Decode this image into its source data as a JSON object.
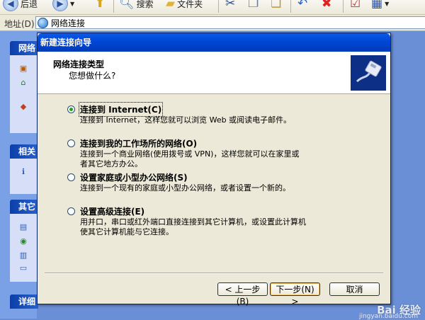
{
  "toolbar": {
    "back_label": "后退",
    "search_label": "搜索",
    "folders_label": "文件夹"
  },
  "address": {
    "label": "地址(D)",
    "value": "网络连接"
  },
  "taskpane": {
    "sections": [
      "网络",
      "相关",
      "其它",
      "详细"
    ]
  },
  "dialog": {
    "title": "新建连接向导",
    "header_title": "网络连接类型",
    "header_subtitle": "您想做什么?",
    "options": [
      {
        "label": "连接到 Internet(C)",
        "desc": "连接到 Internet，这样您就可以浏览 Web 或阅读电子邮件。",
        "checked": true
      },
      {
        "label": "连接到我的工作场所的网络(O)",
        "desc": "连接到一个商业网络(使用拨号或 VPN)，这样您就可以在家里或者其它地方办公。",
        "checked": false
      },
      {
        "label": "设置家庭或小型办公网络(S)",
        "desc": "连接到一个现有的家庭或小型办公网络，或者设置一个新的。",
        "checked": false
      },
      {
        "label": "设置高级连接(E)",
        "desc": "用并口，串口或红外端口直接连接到其它计算机，或设置此计算机使其它计算机能与它连接。",
        "checked": false
      }
    ],
    "buttons": {
      "back": "< 上一步(B)",
      "next": "下一步(N) >",
      "cancel": "取消"
    }
  },
  "watermark": {
    "text": "Bai 经验",
    "url": "jingyan.baidu.com"
  },
  "colors": {
    "titlebar": "#0046d5",
    "dialog_bg": "#ece9d8",
    "header_icon_bg": "#0e2f86",
    "taskpane_bg": "#7aa1e6"
  }
}
